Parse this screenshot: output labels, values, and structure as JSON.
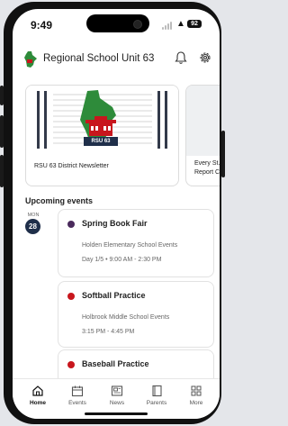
{
  "status_bar": {
    "time": "9:49",
    "battery": "92"
  },
  "app": {
    "title": "Regional School Unit 63"
  },
  "news": [
    {
      "title": "RSU 63 District Newsletter",
      "badge": "RSU 63"
    },
    {
      "title": "Every St... Report C..."
    }
  ],
  "events_section": {
    "title": "Upcoming events"
  },
  "date": {
    "month": "MON",
    "day": "28"
  },
  "events": [
    {
      "title": "Spring Book Fair",
      "location": "Holden Elementary School Events",
      "time": "Day 1/5 • 9:00 AM - 2:30 PM",
      "color": "#4a2a5c"
    },
    {
      "title": "Softball Practice",
      "location": "Holbrook Middle School Events",
      "time": "3:15 PM - 4:45 PM",
      "color": "#c8161d"
    },
    {
      "title": "Baseball Practice",
      "color": "#c8161d"
    }
  ],
  "tabs": [
    {
      "label": "Home",
      "icon": "home-icon"
    },
    {
      "label": "Events",
      "icon": "calendar-icon"
    },
    {
      "label": "News",
      "icon": "newspaper-icon"
    },
    {
      "label": "Parents",
      "icon": "book-icon"
    },
    {
      "label": "More",
      "icon": "grid-icon"
    }
  ],
  "colors": {
    "brand_green": "#2e8b3a",
    "navy": "#1f2f4a",
    "accent_red": "#c8161d"
  }
}
